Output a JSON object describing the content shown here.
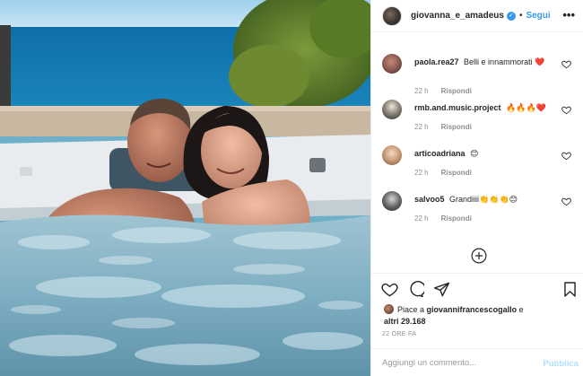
{
  "post": {
    "username": "giovanna_e_amadeus",
    "follow_label": "Segui",
    "separator": "•",
    "more_label": "•••"
  },
  "comments": [
    {
      "user": "paola.rea27",
      "text": "Belli e innammorati ❤️",
      "time": "22 h",
      "reply": "Rispondi"
    },
    {
      "user": "rmb.and.music.project",
      "text": "🔥🔥🔥❤️",
      "time": "22 h",
      "reply": "Rispondi"
    },
    {
      "user": "articoadriana",
      "text": "😊",
      "time": "22 h",
      "reply": "Rispondi"
    },
    {
      "user": "salvoo5",
      "text": "Grandiiii👏👏👏😊",
      "time": "22 h",
      "reply": "Rispondi"
    }
  ],
  "likes": {
    "prefix": "Piace a",
    "user": "giovannifrancescogallo",
    "conjunction": "e",
    "others": "altri 29.168"
  },
  "timestamp": "22 ORE FA",
  "add_comment": {
    "placeholder": "Aggiungi un commento...",
    "publish_label": "Pubblica"
  },
  "icons": {
    "verified": "verified-badge-icon",
    "like": "heart-icon",
    "comment": "comment-bubble-icon",
    "share": "paper-plane-icon",
    "save": "bookmark-icon",
    "load_more": "plus-circle-icon",
    "comment_like": "small-heart-icon"
  },
  "colors": {
    "link_blue": "#3897f0",
    "publish_disabled": "#b2dffc",
    "muted": "#8e8e8e",
    "border": "#efefef"
  }
}
